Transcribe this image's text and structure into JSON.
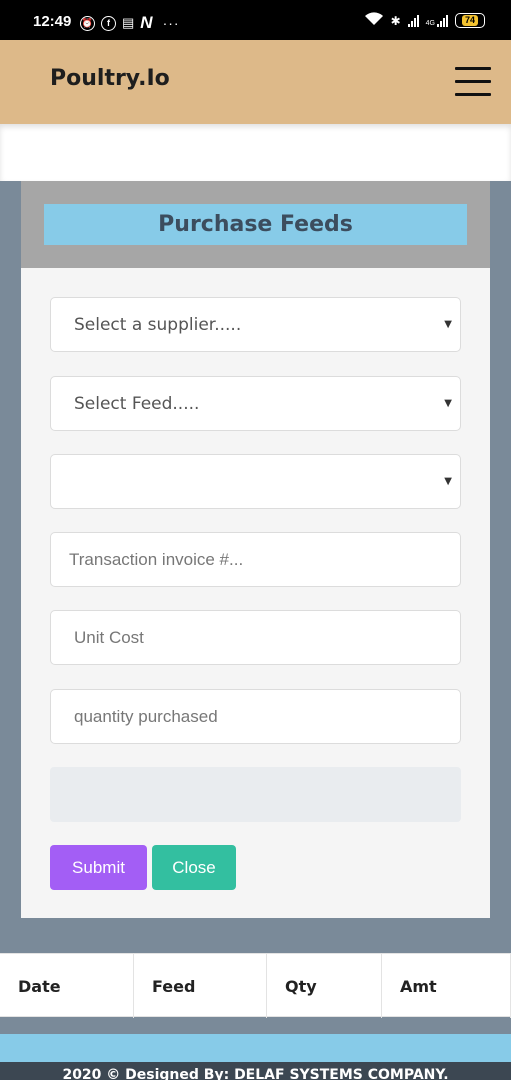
{
  "status_bar": {
    "time": "12:49",
    "network_type": "4G",
    "battery": "74",
    "more": "···"
  },
  "navbar": {
    "brand": "Poultry.Io"
  },
  "modal": {
    "title": "Purchase Feeds",
    "selects": {
      "supplier": "Select a supplier.....",
      "feed": "Select Feed.....",
      "third": ""
    },
    "inputs": {
      "invoice_placeholder": "Transaction invoice #...",
      "unit_cost_placeholder": "Unit Cost",
      "quantity_placeholder": "quantity purchased"
    },
    "buttons": {
      "submit": "Submit",
      "close": "Close"
    }
  },
  "table": {
    "headers": [
      "Date",
      "Feed",
      "Qty",
      "Amt"
    ]
  },
  "footer": {
    "text": "2020 © Designed By: DELAF SYSTEMS COMPANY."
  }
}
